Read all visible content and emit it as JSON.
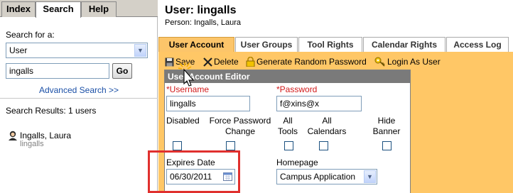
{
  "left_tabs": [
    "Index",
    "Search",
    "Help"
  ],
  "search": {
    "search_for_label": "Search for a:",
    "type_value": "User",
    "query_value": "ingalls",
    "go_label": "Go",
    "advanced_link": "Advanced Search >>",
    "results_label": "Search Results: 1 users",
    "result_name": "Ingalls, Laura",
    "result_username": "lingalls"
  },
  "header": {
    "title": "User: lingalls",
    "person": "Person: Ingalls, Laura"
  },
  "tabs": [
    "User Account",
    "User Groups",
    "Tool Rights",
    "Calendar Rights",
    "Access Log"
  ],
  "toolbar": {
    "save": "Save",
    "delete": "Delete",
    "generate_password": "Generate Random Password",
    "login_as": "Login As User"
  },
  "editor": {
    "heading": "User Account Editor",
    "username_label": "*Username",
    "username_value": "lingalls",
    "password_label": "*Password",
    "password_value": "f@xins@x",
    "flags": [
      {
        "line1": "Disabled",
        "line2": ""
      },
      {
        "line1": "Force Password",
        "line2": "Change"
      },
      {
        "line1": "All",
        "line2": "Tools"
      },
      {
        "line1": "All",
        "line2": "Calendars"
      },
      {
        "line1": "Hide",
        "line2": "Banner"
      }
    ],
    "expires_label": "Expires Date",
    "expires_value": "06/30/2011",
    "homepage_label": "Homepage",
    "homepage_value": "Campus Application"
  },
  "colors": {
    "content_bg": "#ffc766",
    "active_tab": "#fcc56a",
    "highlight": "#e0302e",
    "link": "#1a4fa6",
    "required": "#d21a1a"
  }
}
